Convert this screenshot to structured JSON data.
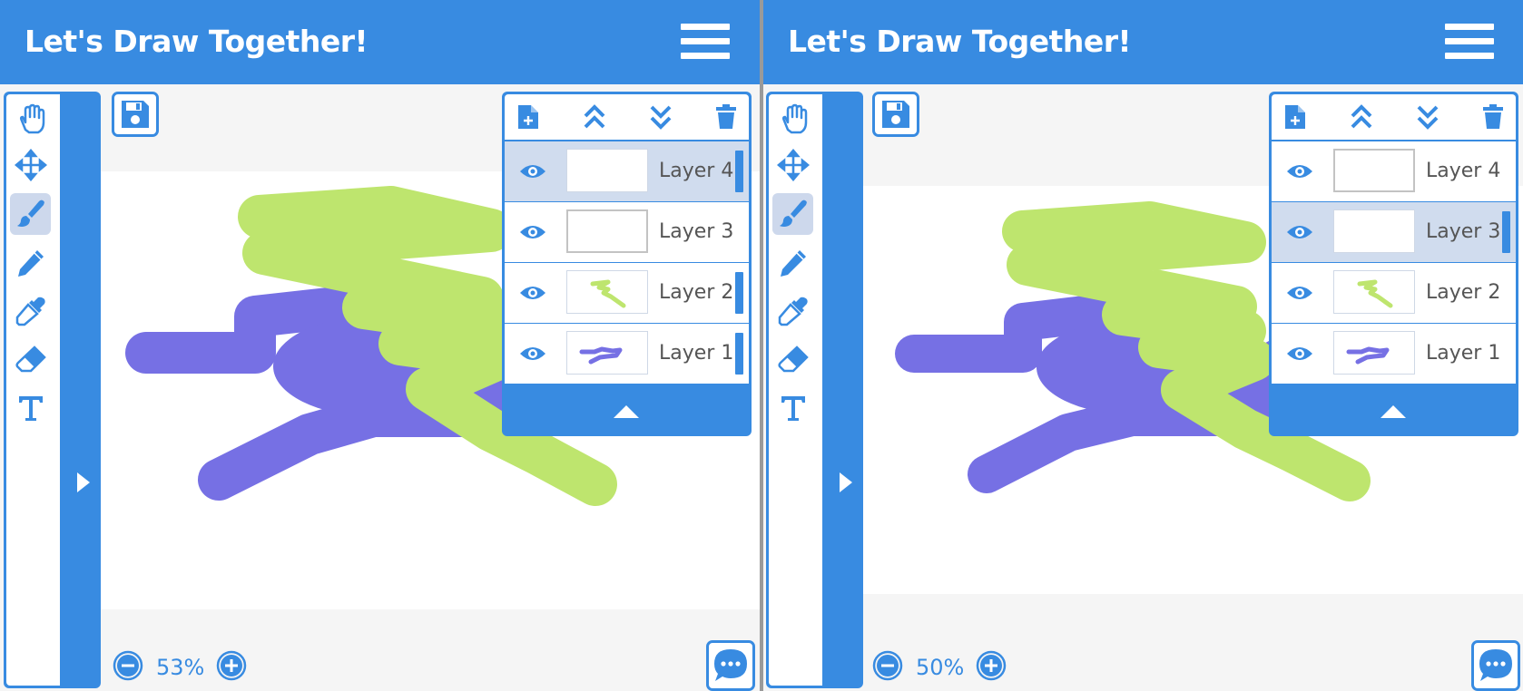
{
  "colors": {
    "accent": "#388be1",
    "active_tool_bg": "#cdd8ec",
    "selected_layer_bg": "#d0dcee",
    "stroke_purple": "#7670e4",
    "stroke_green": "#bee56e"
  },
  "panels": [
    {
      "header": {
        "title": "Let's Draw Together!",
        "menu_icon": "hamburger-menu-icon"
      },
      "tools": [
        {
          "name": "hand-tool",
          "icon": "hand-icon",
          "active": false
        },
        {
          "name": "move-tool",
          "icon": "move-arrows-icon",
          "active": false
        },
        {
          "name": "brush-tool",
          "icon": "paintbrush-icon",
          "active": true
        },
        {
          "name": "pencil-tool",
          "icon": "pencil-icon",
          "active": false
        },
        {
          "name": "eyedropper-tool",
          "icon": "eyedropper-icon",
          "active": false
        },
        {
          "name": "eraser-tool",
          "icon": "eraser-icon",
          "active": false
        },
        {
          "name": "text-tool",
          "icon": "text-icon",
          "active": false
        }
      ],
      "layers_toolbar": [
        "new-layer-icon",
        "move-layer-up-icon",
        "move-layer-down-icon",
        "delete-layer-icon"
      ],
      "layers": [
        {
          "label": "Layer 4",
          "selected": true,
          "indicator": true
        },
        {
          "label": "Layer 3",
          "selected": false,
          "indicator": false
        },
        {
          "label": "Layer 2",
          "selected": false,
          "indicator": true
        },
        {
          "label": "Layer 1",
          "selected": false,
          "indicator": true
        }
      ],
      "zoom": {
        "level": "53%",
        "zoom_out_icon": "minus-circle-icon",
        "zoom_in_icon": "plus-circle-icon"
      },
      "chat_icon": "chat-bubble-icon"
    },
    {
      "header": {
        "title": "Let's Draw Together!",
        "menu_icon": "hamburger-menu-icon"
      },
      "tools": [
        {
          "name": "hand-tool",
          "icon": "hand-icon",
          "active": false
        },
        {
          "name": "move-tool",
          "icon": "move-arrows-icon",
          "active": false
        },
        {
          "name": "brush-tool",
          "icon": "paintbrush-icon",
          "active": true
        },
        {
          "name": "pencil-tool",
          "icon": "pencil-icon",
          "active": false
        },
        {
          "name": "eyedropper-tool",
          "icon": "eyedropper-icon",
          "active": false
        },
        {
          "name": "eraser-tool",
          "icon": "eraser-icon",
          "active": false
        },
        {
          "name": "text-tool",
          "icon": "text-icon",
          "active": false
        }
      ],
      "layers_toolbar": [
        "new-layer-icon",
        "move-layer-up-icon",
        "move-layer-down-icon",
        "delete-layer-icon"
      ],
      "layers": [
        {
          "label": "Layer 4",
          "selected": false,
          "indicator": false
        },
        {
          "label": "Layer 3",
          "selected": true,
          "indicator": true
        },
        {
          "label": "Layer 2",
          "selected": false,
          "indicator": false
        },
        {
          "label": "Layer 1",
          "selected": false,
          "indicator": false
        }
      ],
      "zoom": {
        "level": "50%",
        "zoom_out_icon": "minus-circle-icon",
        "zoom_in_icon": "plus-circle-icon"
      },
      "chat_icon": "chat-bubble-icon"
    }
  ]
}
